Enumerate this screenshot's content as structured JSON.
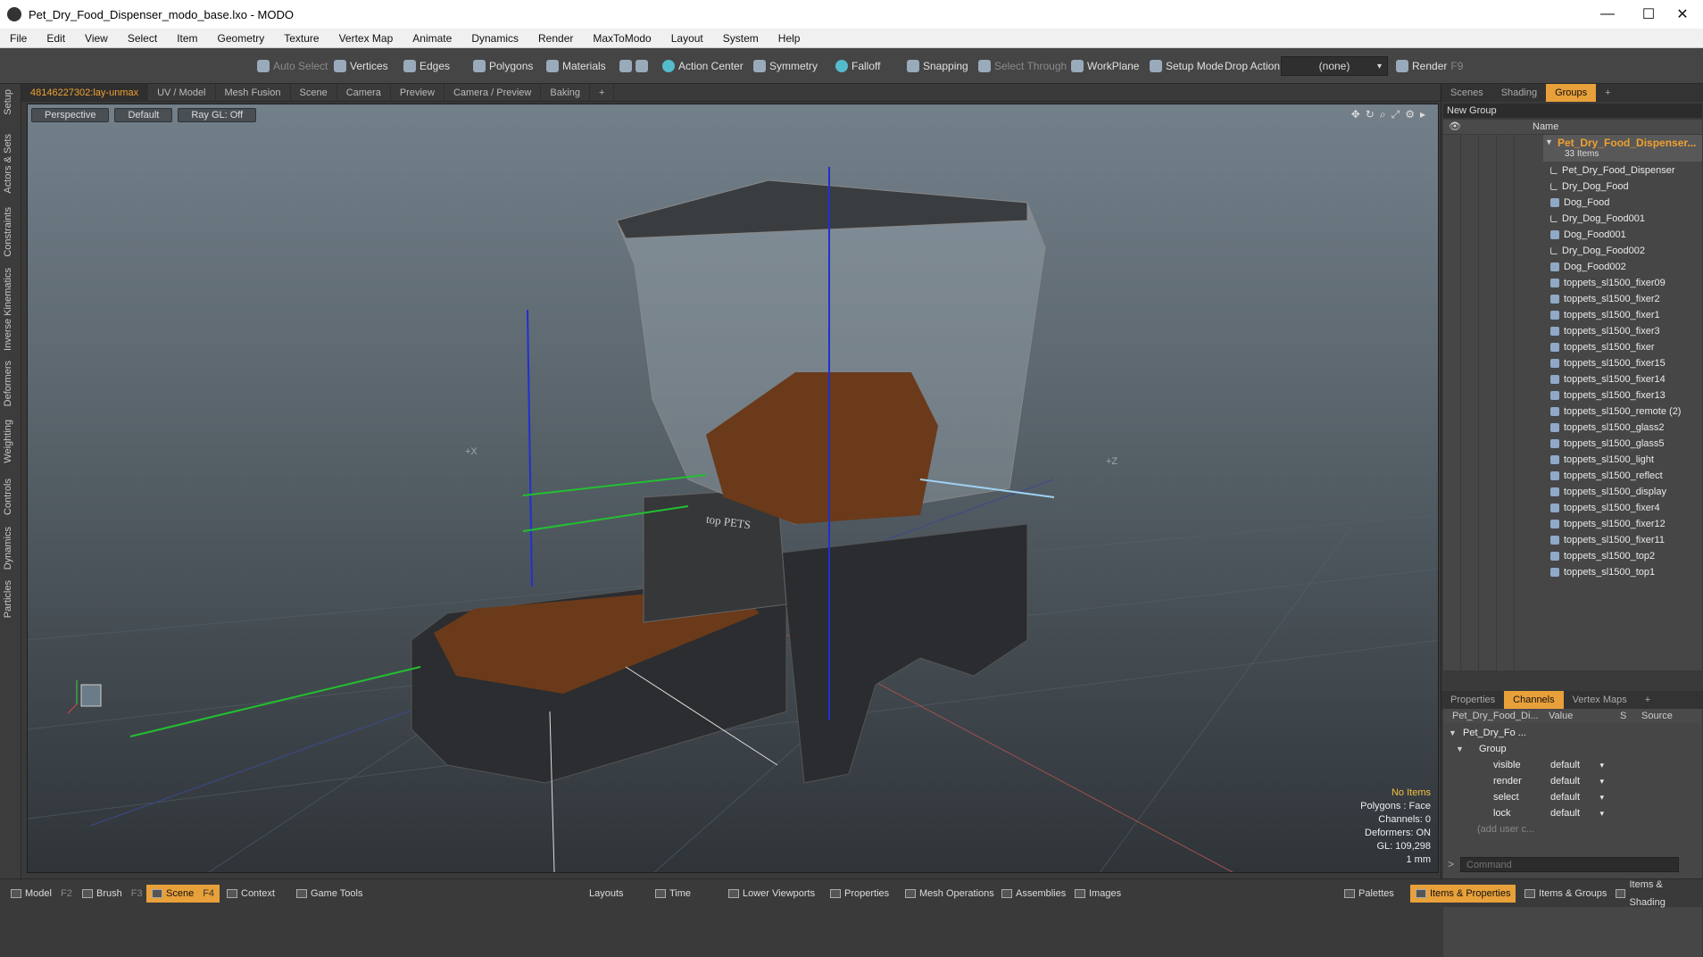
{
  "window": {
    "title": "Pet_Dry_Food_Dispenser_modo_base.lxo - MODO",
    "minimize": "—",
    "maximize": "☐",
    "close": "✕"
  },
  "menu": [
    "File",
    "Edit",
    "View",
    "Select",
    "Item",
    "Geometry",
    "Texture",
    "Vertex Map",
    "Animate",
    "Dynamics",
    "Render",
    "MaxToModo",
    "Layout",
    "System",
    "Help"
  ],
  "toolbar": {
    "auto_select": "Auto Select",
    "vertices": "Vertices",
    "edges": "Edges",
    "polygons": "Polygons",
    "materials": "Materials",
    "action_center": "Action Center",
    "symmetry": "Symmetry",
    "falloff": "Falloff",
    "snapping": "Snapping",
    "select_through": "Select Through",
    "workplane": "WorkPlane",
    "setup_mode": "Setup Mode",
    "drop_action": "Drop Action",
    "drop_value": "(none)",
    "render": "Render",
    "render_key": "F9"
  },
  "left_tabs": [
    "Setup",
    "Actors & Sets",
    "Constraints",
    "Inverse Kinematics",
    "Deformers",
    "Weighting",
    "Controls",
    "Dynamics",
    "Particles"
  ],
  "viewport_tabs": [
    "48146227302:lay-unmax",
    "UV / Model",
    "Mesh Fusion",
    "Scene",
    "Camera",
    "Preview",
    "Camera / Preview",
    "Baking",
    "+"
  ],
  "viewport": {
    "view": "Perspective",
    "shading": "Default",
    "raygl": "Ray GL: Off",
    "axis_x": "+X",
    "axis_z": "+Z",
    "stats": {
      "items": "No Items",
      "polygons": "Polygons : Face",
      "channels": "Channels: 0",
      "deformers": "Deformers: ON",
      "gl": "GL: 109,298",
      "unit": "1 mm"
    },
    "label_brand": "top PETS"
  },
  "groups_panel": {
    "tabs": [
      "Scenes",
      "Shading",
      "Groups",
      "+"
    ],
    "new_group": "New Group",
    "name_header": "Name",
    "group_name": "Pet_Dry_Food_Dispenser...",
    "group_count": "33 Items",
    "items": [
      {
        "name": "Pet_Dry_Food_Dispenser",
        "type": "locator"
      },
      {
        "name": "Dry_Dog_Food",
        "type": "locator"
      },
      {
        "name": "Dog_Food",
        "type": "mesh"
      },
      {
        "name": "Dry_Dog_Food001",
        "type": "locator"
      },
      {
        "name": "Dog_Food001",
        "type": "mesh"
      },
      {
        "name": "Dry_Dog_Food002",
        "type": "locator"
      },
      {
        "name": "Dog_Food002",
        "type": "mesh"
      },
      {
        "name": "toppets_sl1500_fixer09",
        "type": "mesh"
      },
      {
        "name": "toppets_sl1500_fixer2",
        "type": "mesh"
      },
      {
        "name": "toppets_sl1500_fixer1",
        "type": "mesh"
      },
      {
        "name": "toppets_sl1500_fixer3",
        "type": "mesh"
      },
      {
        "name": "toppets_sl1500_fixer",
        "type": "mesh"
      },
      {
        "name": "toppets_sl1500_fixer15",
        "type": "mesh"
      },
      {
        "name": "toppets_sl1500_fixer14",
        "type": "mesh"
      },
      {
        "name": "toppets_sl1500_fixer13",
        "type": "mesh"
      },
      {
        "name": "toppets_sl1500_remote (2)",
        "type": "mesh"
      },
      {
        "name": "toppets_sl1500_glass2",
        "type": "mesh"
      },
      {
        "name": "toppets_sl1500_glass5",
        "type": "mesh"
      },
      {
        "name": "toppets_sl1500_light",
        "type": "mesh"
      },
      {
        "name": "toppets_sl1500_reflect",
        "type": "mesh"
      },
      {
        "name": "toppets_sl1500_display",
        "type": "mesh"
      },
      {
        "name": "toppets_sl1500_fixer4",
        "type": "mesh"
      },
      {
        "name": "toppets_sl1500_fixer12",
        "type": "mesh"
      },
      {
        "name": "toppets_sl1500_fixer11",
        "type": "mesh"
      },
      {
        "name": "toppets_sl1500_top2",
        "type": "mesh"
      },
      {
        "name": "toppets_sl1500_top1",
        "type": "mesh"
      }
    ]
  },
  "channels_panel": {
    "tabs": [
      "Properties",
      "Channels",
      "Vertex Maps",
      "+"
    ],
    "col_name": "Pet_Dry_Food_Di...",
    "col_value": "Value",
    "col_s": "S",
    "col_source": "Source",
    "root": "Pet_Dry_Fo ...",
    "group": "Group",
    "rows": [
      {
        "key": "visible",
        "value": "default"
      },
      {
        "key": "render",
        "value": "default"
      },
      {
        "key": "select",
        "value": "default"
      },
      {
        "key": "lock",
        "value": "default"
      }
    ],
    "add_user": "(add user c..."
  },
  "command": {
    "prompt": ">",
    "placeholder": "Command"
  },
  "bottombar": {
    "model": "Model",
    "model_key": "F2",
    "brush": "Brush",
    "brush_key": "F3",
    "scene": "Scene",
    "scene_key": "F4",
    "context": "Context",
    "game_tools": "Game Tools",
    "layouts": "Layouts",
    "time": "Time",
    "lower_viewports": "Lower Viewports",
    "properties": "Properties",
    "mesh_operations": "Mesh Operations",
    "assemblies": "Assemblies",
    "images": "Images",
    "palettes": "Palettes",
    "items_properties": "Items & Properties",
    "items_groups": "Items & Groups",
    "items_shading": "Items & Shading"
  },
  "colors": {
    "accent": "#e8a03a"
  }
}
